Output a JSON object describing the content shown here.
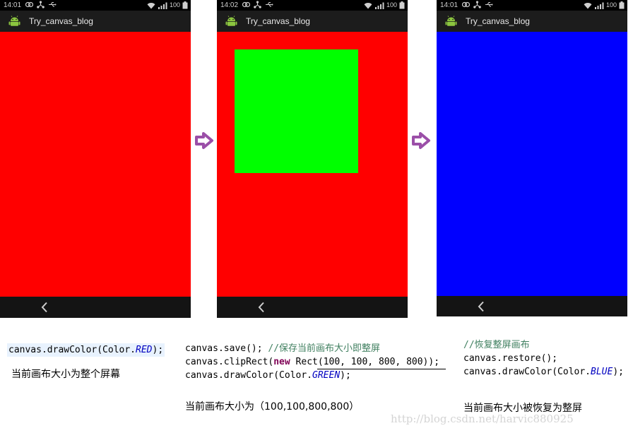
{
  "colors": {
    "screen1_bg": "#ff0000",
    "screen2_bg": "#ff0000",
    "screen2_clip": "#00ff00",
    "screen3_bg": "#0000ff",
    "arrow": "#9b4fa8"
  },
  "screens": [
    {
      "time": "14:01",
      "battery": "100",
      "title": "Try_canvas_blog"
    },
    {
      "time": "14:02",
      "battery": "100",
      "title": "Try_canvas_blog"
    },
    {
      "time": "14:01",
      "battery": "100",
      "title": "Try_canvas_blog"
    }
  ],
  "code1": {
    "pre": "canvas.drawColor(Color.",
    "field": "RED",
    "post": ");"
  },
  "caption1": "当前画布大小为整个屏幕",
  "code2": {
    "line1_code": "canvas.save(); ",
    "line1_comment": "//保存当前画布大小即整屏",
    "line2_pre": "canvas.clipRect(",
    "line2_kw": "new",
    "line2_post": " Rect(100, 100, 800, 800));",
    "line3_pre": "canvas.drawColor(Color.",
    "line3_field": "GREEN",
    "line3_post": ");"
  },
  "caption2": "当前画布大小为（100,100,800,800）",
  "code3": {
    "comment": "//恢复整屏画布",
    "line2": "canvas.restore();",
    "line3_pre": "canvas.drawColor(Color.",
    "line3_field": "BLUE",
    "line3_post": ");"
  },
  "caption3": "当前画布大小被恢复为整屏",
  "watermark": "http://blog.csdn.net/harvic880925"
}
